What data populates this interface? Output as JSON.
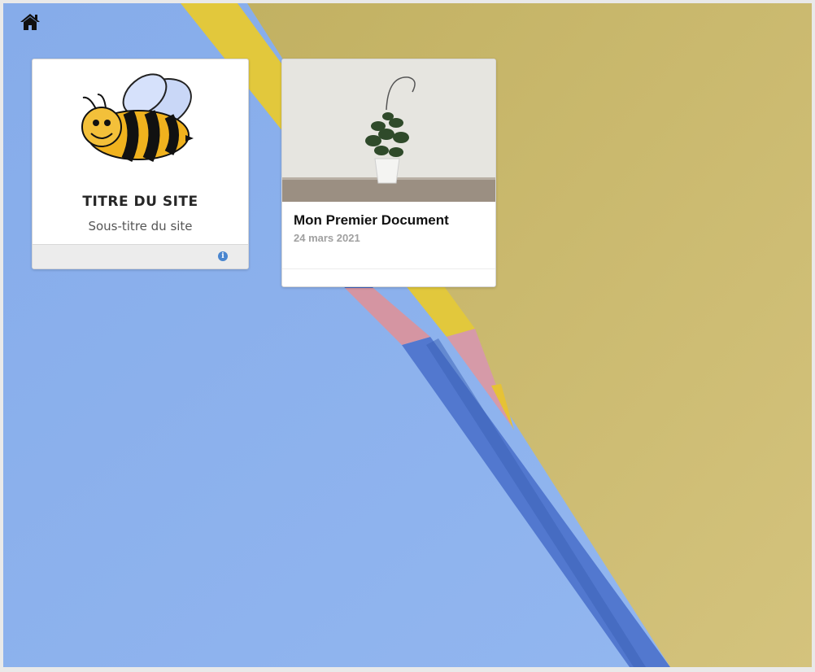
{
  "home": {
    "icon": "home-icon"
  },
  "site_card": {
    "logo": "bee-logo",
    "title": "TITRE DU SITE",
    "subtitle": "Sous-titre du site",
    "info_icon": "info-icon"
  },
  "document_card": {
    "image": "plant-photo",
    "title": "Mon Premier Document",
    "date": "24 mars 2021"
  },
  "background": {
    "image": "colored-pencils-photo",
    "blue": "#8fb4ee",
    "yellow": "#cdbb72"
  }
}
